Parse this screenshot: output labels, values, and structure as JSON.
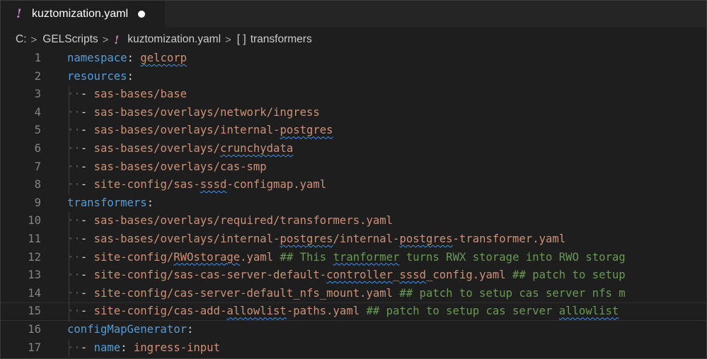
{
  "tab": {
    "icon": "yaml-exclamation-icon",
    "title": "kuztomization.yaml",
    "modified": true
  },
  "breadcrumbs": {
    "drive": "C:",
    "folder": "GELScripts",
    "file": "kuztomization.yaml",
    "symbol_icon": "[ ]",
    "symbol": "transformers"
  },
  "colors": {
    "key": "#569cd6",
    "value": "#ce9178",
    "comment": "#6a9955",
    "line_number": "#858585",
    "background": "#1e1e1e"
  },
  "editor": {
    "current_line": 15,
    "lines": [
      {
        "n": "1",
        "key": "namespace",
        "punct": ": ",
        "val": "gelcorp"
      },
      {
        "n": "2",
        "key": "resources",
        "punct": ":"
      },
      {
        "n": "3",
        "dash": "- ",
        "val": "sas-bases/base"
      },
      {
        "n": "4",
        "dash": "- ",
        "val": "sas-bases/overlays/network/ingress"
      },
      {
        "n": "5",
        "dash": "- ",
        "val": "sas-bases/overlays/internal-postgres"
      },
      {
        "n": "6",
        "dash": "- ",
        "val": "sas-bases/overlays/crunchydata"
      },
      {
        "n": "7",
        "dash": "- ",
        "val": "sas-bases/overlays/cas-smp"
      },
      {
        "n": "8",
        "dash": "- ",
        "val": "site-config/sas-sssd-configmap.yaml"
      },
      {
        "n": "9",
        "key": "transformers",
        "punct": ":"
      },
      {
        "n": "10",
        "dash": "- ",
        "val": "sas-bases/overlays/required/transformers.yaml"
      },
      {
        "n": "11",
        "dash": "- ",
        "val": "sas-bases/overlays/internal-postgres/internal-postgres-transformer.yaml"
      },
      {
        "n": "12",
        "dash": "- ",
        "val": "site-config/RWOstorage.yaml",
        "comment": " ## This tranformer turns RWX storage into RWO storag"
      },
      {
        "n": "13",
        "dash": "- ",
        "val": "site-config/sas-cas-server-default-controller_sssd_config.yaml",
        "comment": " ## patch to setup"
      },
      {
        "n": "14",
        "dash": "- ",
        "val": "site-config/cas-server-default_nfs_mount.yaml",
        "comment": " ## patch to setup cas server nfs m"
      },
      {
        "n": "15",
        "dash": "- ",
        "val": "site-config/cas-add-allowlist-paths.yaml",
        "comment": " ## patch to setup cas server allowlist"
      },
      {
        "n": "16",
        "key": "configMapGenerator",
        "punct": ":"
      },
      {
        "n": "17",
        "dash": "- ",
        "key": "name",
        "punct": ": ",
        "val": "ingress-input"
      }
    ]
  }
}
